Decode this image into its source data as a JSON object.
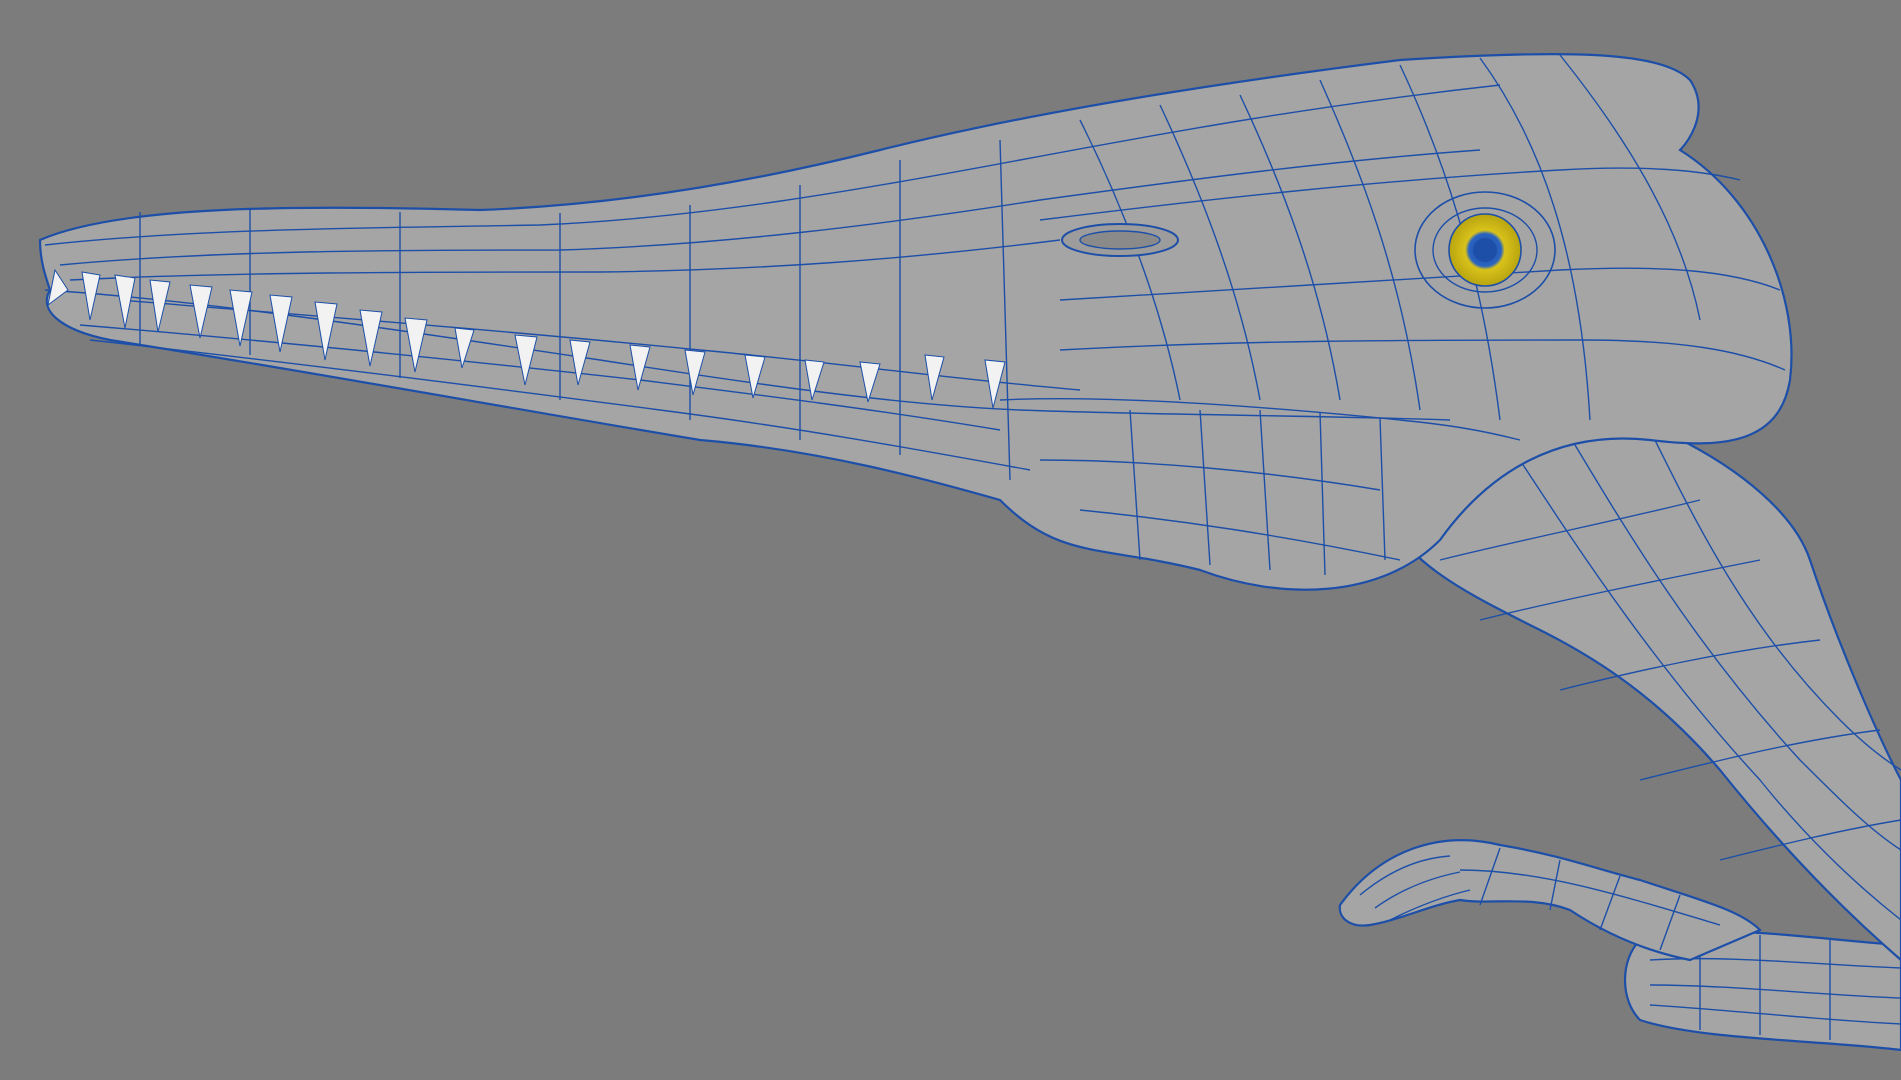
{
  "viewport": {
    "background": "#7c7c7c",
    "subject": "wireframe-3d-model",
    "wire_color": "#1d4fa8",
    "surface_color": "#a5a5a5",
    "eye_color": "#d8c21a",
    "tooth_color": "#f2f2f2"
  }
}
